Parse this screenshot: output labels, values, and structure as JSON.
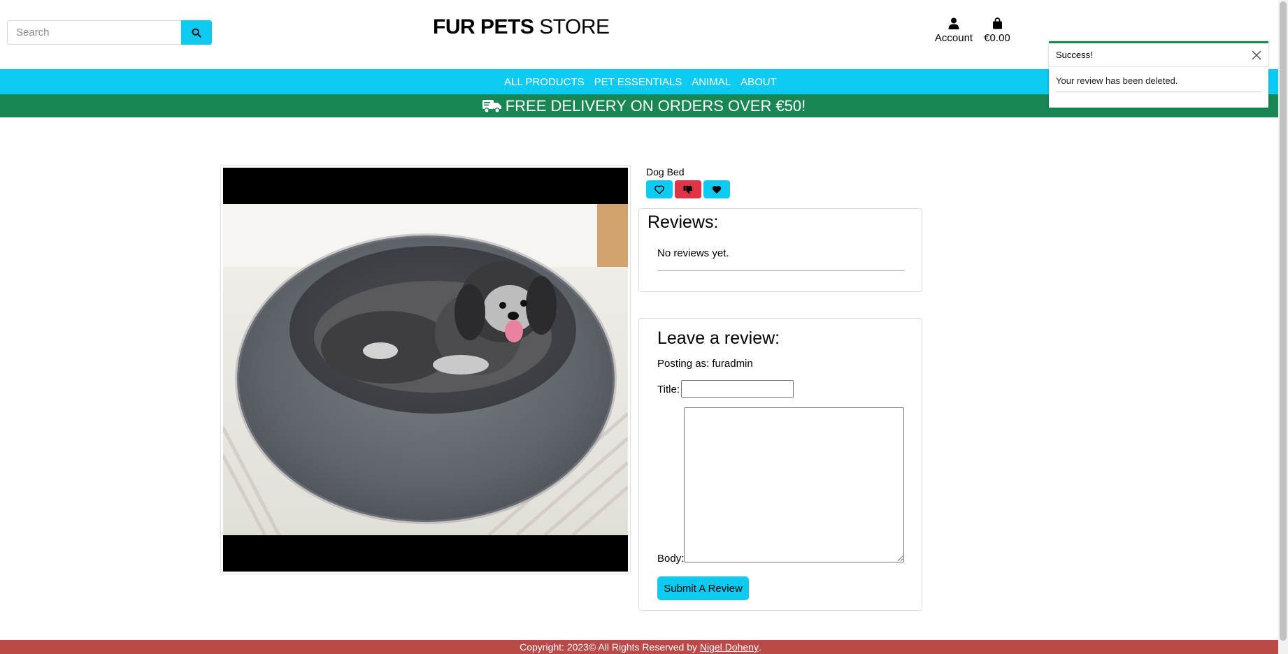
{
  "header": {
    "search_placeholder": "Search",
    "logo_bold": "FUR PETS",
    "logo_light": " STORE",
    "account_label": "Account",
    "bag_total": "€0.00"
  },
  "nav": {
    "items": [
      "ALL PRODUCTS",
      "PET ESSENTIALS",
      "ANIMAL",
      "ABOUT"
    ]
  },
  "promo": {
    "text": "FREE DELIVERY ON ORDERS OVER €50!"
  },
  "toast": {
    "title": "Success!",
    "message": "Your review has been deleted."
  },
  "product": {
    "name": "Dog Bed",
    "actions": [
      "heart-outline-icon",
      "thumbs-down-icon",
      "heart-filled-icon"
    ]
  },
  "reviews": {
    "heading": "Reviews:",
    "empty_text": "No reviews yet."
  },
  "review_form": {
    "heading": "Leave a review:",
    "posting_as": "Posting as: furadmin",
    "title_label": "Title:",
    "title_value": "",
    "body_label": "Body:",
    "body_value": "",
    "submit_label": "Submit A Review"
  },
  "footer": {
    "text": "Copyright: 2023© All Rights Reserved by ",
    "link": "Nigel Doheny",
    "suffix": "."
  },
  "colors": {
    "cyan": "#0dcaf0",
    "green": "#198754",
    "red": "#dc3545",
    "footer": "#b94a48"
  }
}
